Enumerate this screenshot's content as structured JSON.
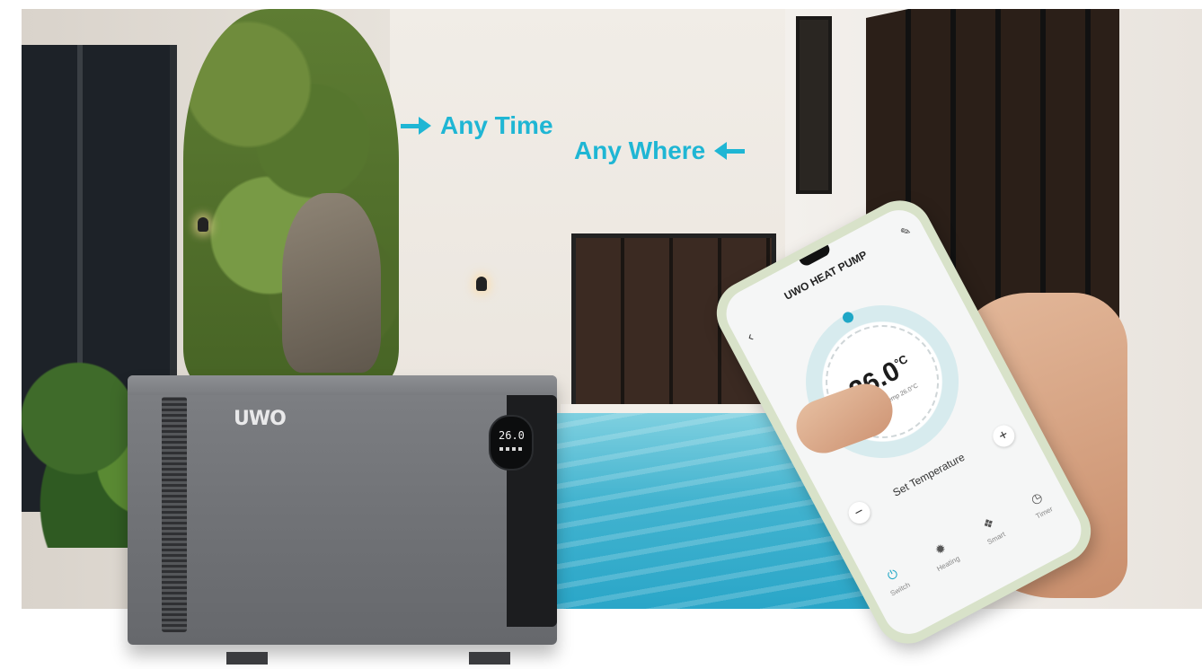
{
  "slogan": {
    "line1": "Any Time",
    "line2": "Any Where"
  },
  "device": {
    "brand": "UWO",
    "display_reading": "26.0"
  },
  "app": {
    "title": "UWO HEAT PUMP",
    "back_icon": "chevron-left-icon",
    "edit_icon": "edit-icon",
    "temperature": {
      "value": "26.0",
      "unit": "°C",
      "current_label": "Current Temp  26.0°C"
    },
    "set_temperature": {
      "label": "Set Temperature",
      "minus": "−",
      "plus": "+"
    },
    "tabs": [
      {
        "label": "Switch",
        "icon": "power-icon",
        "active": true
      },
      {
        "label": "Heating",
        "icon": "sun-icon",
        "active": false
      },
      {
        "label": "Smart",
        "icon": "smart-icon",
        "active": false
      },
      {
        "label": "Timer",
        "icon": "clock-icon",
        "active": false
      }
    ]
  },
  "colors": {
    "accent": "#1fb6d4",
    "device_body": "#717377",
    "pool": "#42b3cf"
  }
}
